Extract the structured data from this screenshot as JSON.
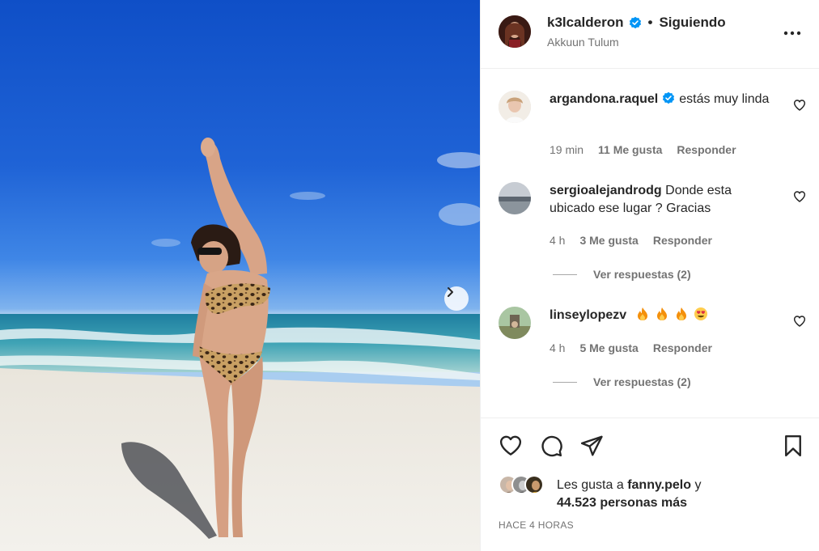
{
  "post": {
    "author": "k3lcalderon",
    "follow_state": "Siguiendo",
    "separator": "•",
    "location": "Akkuun Tulum",
    "next_icon": "chevron-right-icon",
    "more_icon": "more-horizontal-icon"
  },
  "comments": [
    {
      "user": "argandona.raquel",
      "verified": true,
      "text": "estás muy linda",
      "time": "19 min",
      "likes": "11 Me gusta",
      "reply": "Responder"
    },
    {
      "user": "sergioalejandrodg",
      "verified": false,
      "text": "Donde esta ubicado ese lugar ? Gracias",
      "time": "4 h",
      "likes": "3 Me gusta",
      "reply": "Responder",
      "view_replies": "Ver respuestas (2)"
    },
    {
      "user": "linseylopezv",
      "verified": false,
      "text": "",
      "emojis": [
        "fire-emoji",
        "fire-emoji",
        "fire-emoji",
        "heart-eyes-emoji"
      ],
      "time": "4 h",
      "likes": "5 Me gusta",
      "reply": "Responder",
      "view_replies": "Ver respuestas (2)"
    }
  ],
  "actions": {
    "icons": [
      "heart-icon",
      "comment-icon",
      "share-icon",
      "bookmark-icon"
    ],
    "likes_prefix": "Les gusta a",
    "liker": "fanny.pelo",
    "likes_conj": "y",
    "likes_count": "44.523 personas más",
    "time_ago": "HACE 4 HORAS"
  },
  "colors": {
    "verified": "#0095f6",
    "text": "#262626",
    "secondary": "#737373",
    "border": "#efefef"
  }
}
